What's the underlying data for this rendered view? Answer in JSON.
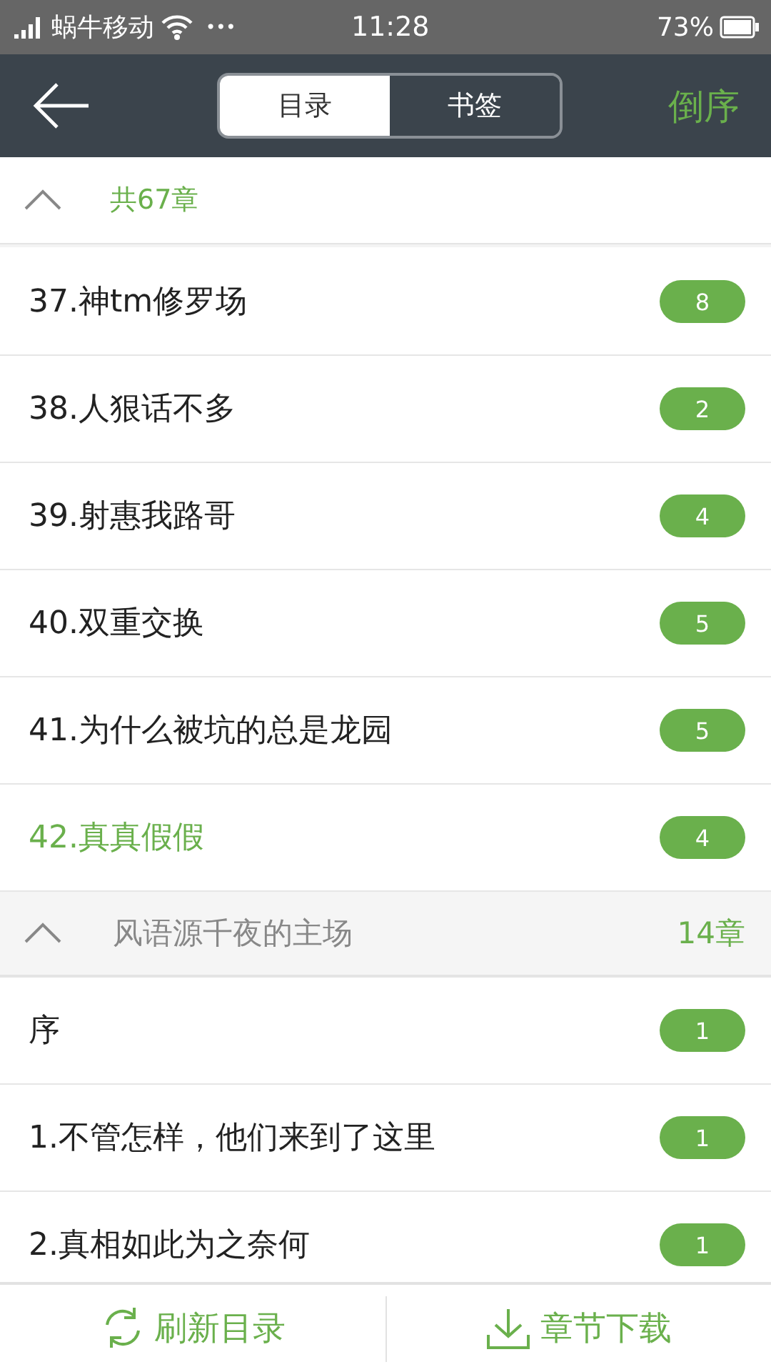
{
  "status_bar": {
    "carrier": "蜗牛移动",
    "dots": "•••",
    "time": "11:28",
    "battery": "73%"
  },
  "header": {
    "tabs": [
      {
        "label": "目录",
        "selected": true
      },
      {
        "label": "书签",
        "selected": false
      }
    ],
    "sort_button": "倒序"
  },
  "groups": [
    {
      "count": "共67章",
      "expanded": true,
      "chapters": [
        {
          "title": "37.神tm修罗场",
          "badge": "8",
          "selected": false
        },
        {
          "title": "38.人狠话不多",
          "badge": "2",
          "selected": false
        },
        {
          "title": "39.射惠我路哥",
          "badge": "4",
          "selected": false
        },
        {
          "title": "40.双重交换",
          "badge": "5",
          "selected": false
        },
        {
          "title": "41.为什么被坑的总是龙园",
          "badge": "5",
          "selected": false
        },
        {
          "title": "42.真真假假",
          "badge": "4",
          "selected": true
        }
      ]
    },
    {
      "title": "风语源千夜的主场",
      "count": "14章",
      "expanded": true,
      "chapters": [
        {
          "title": "序",
          "badge": "1",
          "selected": false
        },
        {
          "title": "1.不管怎样，他们来到了这里",
          "badge": "1",
          "selected": false
        },
        {
          "title": "2.真相如此为之奈何",
          "badge": "1",
          "selected": false
        }
      ]
    }
  ],
  "bottom_bar": [
    {
      "kind": "refresh",
      "label": "刷新目录"
    },
    {
      "kind": "download",
      "label": "章节下载"
    }
  ]
}
